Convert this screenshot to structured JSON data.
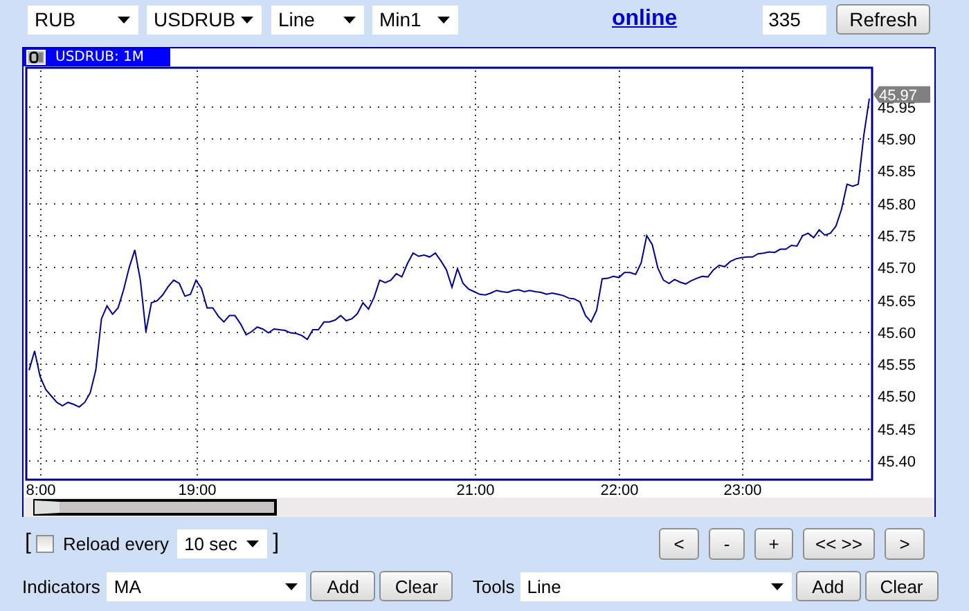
{
  "toolbar": {
    "selectors": [
      {
        "value": "RUB"
      },
      {
        "value": "USDRUB"
      },
      {
        "value": "Line"
      },
      {
        "value": "Min1"
      }
    ],
    "status_link": "online",
    "count": "335",
    "refresh_button": "Refresh"
  },
  "chart": {
    "title": "USDRUB: 1M",
    "chart_data": {
      "type": "line",
      "grid": true,
      "ylim": [
        45.37,
        46.01
      ],
      "categories": [
        null,
        null,
        "8:00",
        null,
        null,
        null,
        null,
        null,
        null,
        null,
        null,
        null,
        null,
        null,
        null,
        null,
        null,
        null,
        null,
        null,
        null,
        null,
        null,
        null,
        null,
        null,
        null,
        null,
        null,
        null,
        "19:00",
        null,
        null,
        null,
        null,
        null,
        null,
        null,
        null,
        null,
        null,
        null,
        null,
        null,
        null,
        null,
        null,
        null,
        null,
        null,
        null,
        null,
        null,
        null,
        null,
        null,
        null,
        null,
        null,
        null,
        null,
        null,
        null,
        null,
        null,
        null,
        null,
        null,
        null,
        null,
        null,
        null,
        null,
        null,
        null,
        null,
        null,
        null,
        null,
        null,
        "21:00",
        null,
        null,
        null,
        null,
        null,
        null,
        null,
        null,
        null,
        null,
        null,
        null,
        null,
        null,
        null,
        null,
        null,
        null,
        null,
        null,
        null,
        null,
        null,
        null,
        null,
        "22:00",
        null,
        null,
        null,
        null,
        null,
        null,
        null,
        null,
        null,
        null,
        null,
        null,
        null,
        null,
        null,
        null,
        null,
        null,
        null,
        null,
        null,
        "23:00",
        null,
        null,
        null,
        null,
        null,
        null,
        null,
        null,
        null,
        null,
        null,
        null,
        null,
        null,
        null,
        null,
        null,
        null,
        null,
        null,
        null,
        null,
        null
      ],
      "yticks": [
        {
          "value": 45.4,
          "label": "45.40"
        },
        {
          "value": 45.45,
          "label": "45.45"
        },
        {
          "value": 45.5,
          "label": "45.50"
        },
        {
          "value": 45.55,
          "label": "45.55"
        },
        {
          "value": 45.6,
          "label": "45.60"
        },
        {
          "value": 45.65,
          "label": "45.65"
        },
        {
          "value": 45.7,
          "label": "45.70"
        },
        {
          "value": 45.75,
          "label": "45.75"
        },
        {
          "value": 45.8,
          "label": "45.80"
        },
        {
          "value": 45.85,
          "label": "45.85"
        },
        {
          "value": 45.9,
          "label": "45.90"
        },
        {
          "value": 45.95,
          "label": "45.95"
        }
      ],
      "series": [
        {
          "color": "#00008b",
          "values": [
            45.54,
            45.57,
            45.53,
            45.51,
            45.5,
            45.49,
            45.485,
            45.49,
            45.487,
            45.483,
            45.49,
            45.505,
            45.54,
            45.62,
            45.64,
            45.627,
            45.637,
            45.665,
            45.7,
            45.727,
            45.68,
            45.6,
            45.645,
            45.648,
            45.657,
            45.67,
            45.68,
            45.675,
            45.655,
            45.658,
            45.68,
            45.667,
            45.637,
            45.637,
            45.624,
            45.615,
            45.625,
            45.625,
            45.612,
            45.595,
            45.6,
            45.607,
            45.604,
            45.598,
            45.604,
            45.603,
            45.602,
            45.598,
            45.597,
            45.594,
            45.588,
            45.603,
            45.603,
            45.615,
            45.615,
            45.618,
            45.625,
            45.617,
            45.62,
            45.628,
            45.645,
            45.635,
            45.653,
            45.68,
            45.676,
            45.68,
            45.69,
            45.685,
            45.706,
            45.722,
            45.717,
            45.719,
            45.716,
            45.722,
            45.71,
            45.696,
            45.669,
            45.698,
            45.675,
            45.666,
            45.662,
            45.658,
            45.657,
            45.66,
            45.664,
            45.662,
            45.661,
            45.664,
            45.665,
            45.662,
            45.664,
            45.662,
            45.661,
            45.658,
            45.66,
            45.658,
            45.656,
            45.652,
            45.651,
            45.646,
            45.625,
            45.615,
            45.633,
            45.682,
            45.683,
            45.686,
            45.684,
            45.692,
            45.692,
            45.689,
            45.707,
            45.749,
            45.735,
            45.699,
            45.68,
            45.675,
            45.681,
            45.677,
            45.674,
            45.679,
            45.683,
            45.686,
            45.685,
            45.696,
            45.703,
            45.701,
            45.709,
            45.713,
            45.715,
            45.716,
            45.716,
            45.721,
            45.722,
            45.724,
            45.723,
            45.728,
            45.728,
            45.734,
            45.733,
            45.749,
            45.753,
            45.746,
            45.758,
            45.75,
            45.753,
            45.764,
            45.79,
            45.829,
            45.826,
            45.829,
            45.905,
            45.962
          ]
        }
      ],
      "annotations": [
        "45.97"
      ]
    }
  },
  "reload": {
    "open_bracket": "[",
    "checked": false,
    "label": "Reload every",
    "interval": "10 sec",
    "close_bracket": "]"
  },
  "nav_buttons": [
    "<",
    "-",
    "+",
    "<< >>",
    ">"
  ],
  "indicators": {
    "label": "Indicators",
    "value": "MA",
    "buttons": [
      "Add",
      "Clear"
    ]
  },
  "tools": {
    "label": "Tools",
    "value": "Line",
    "buttons": [
      "Add",
      "Clear"
    ]
  }
}
